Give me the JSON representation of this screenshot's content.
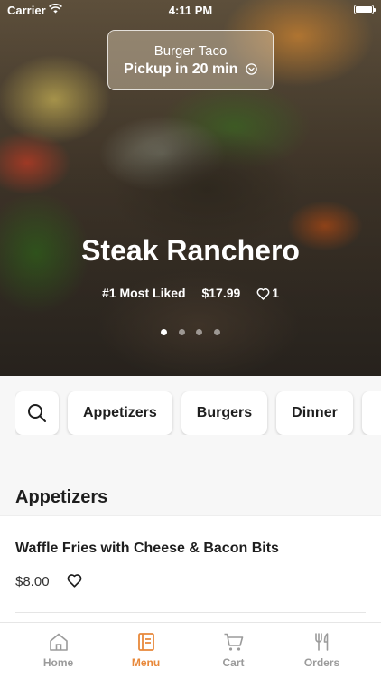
{
  "status_bar": {
    "carrier": "Carrier",
    "time": "4:11 PM"
  },
  "pickup": {
    "restaurant": "Burger Taco",
    "eta": "Pickup in 20 min"
  },
  "hero": {
    "title": "Steak Ranchero",
    "badge": "#1 Most Liked",
    "price": "$17.99",
    "likes": "1",
    "carousel_total": 4,
    "carousel_active": 1
  },
  "categories": [
    "Appetizers",
    "Burgers",
    "Dinner"
  ],
  "section": {
    "title": "Appetizers"
  },
  "items": [
    {
      "name": "Waffle Fries with Cheese & Bacon Bits",
      "price": "$8.00"
    }
  ],
  "tabs": [
    {
      "label": "Home",
      "icon": "home-icon"
    },
    {
      "label": "Menu",
      "icon": "menu-icon"
    },
    {
      "label": "Cart",
      "icon": "cart-icon"
    },
    {
      "label": "Orders",
      "icon": "orders-icon"
    }
  ],
  "colors": {
    "accent": "#e8883a",
    "inactive": "#9b9b9b",
    "text": "#1e1e1e"
  }
}
